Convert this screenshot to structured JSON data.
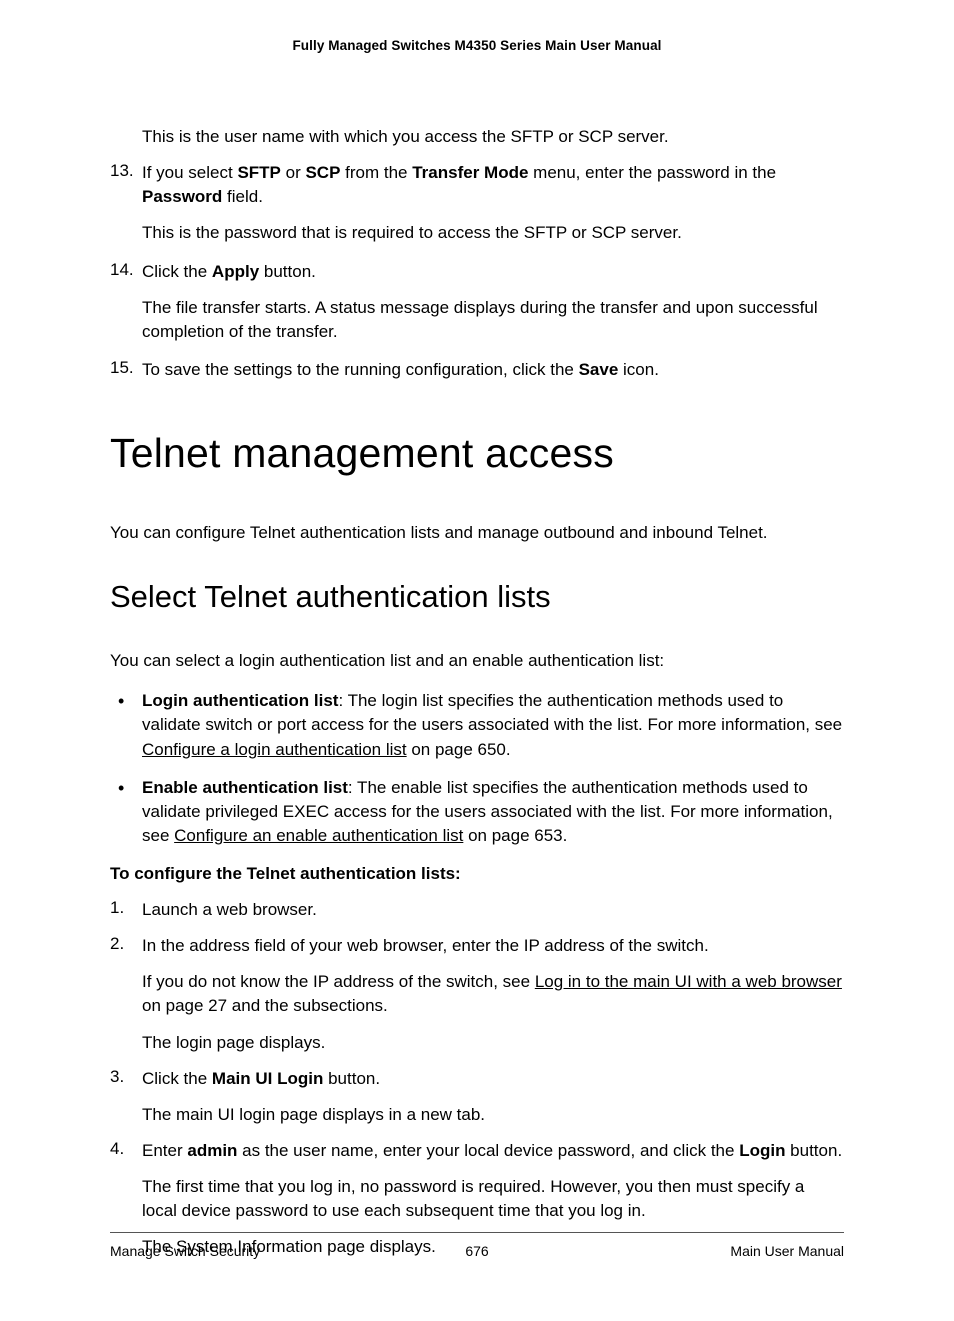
{
  "header": {
    "title": "Fully Managed Switches M4350 Series Main User Manual"
  },
  "cont": {
    "pre_indent": "This is the user name with which you access the SFTP or SCP server.",
    "items": [
      {
        "num": "13.",
        "body_html": "If you select <span class=\"bold\">SFTP</span> or <span class=\"bold\">SCP</span> from the <span class=\"bold\">Transfer Mode</span> menu, enter the password in the <span class=\"bold\">Password</span> field.",
        "after": "This is the password that is required to access the SFTP or SCP server."
      },
      {
        "num": "14.",
        "body_html": "Click the <span class=\"bold\">Apply</span> button.",
        "after": "The file transfer starts. A status message displays during the transfer and upon successful completion of the transfer."
      },
      {
        "num": "15.",
        "body_html": "To save the settings to the running configuration, click the <span class=\"bold\">Save</span> icon."
      }
    ]
  },
  "h1": "Telnet management access",
  "intro1": "You can configure Telnet authentication lists and manage outbound and inbound Telnet.",
  "h2": "Select Telnet authentication lists",
  "intro2": "You can select a login authentication list and an enable authentication list:",
  "bullets": [
    {
      "html": "<span class=\"bold\">Login authentication list</span>: The login list specifies the authentication methods used to validate switch or port access for the users associated with the list. For more information, see <span class=\"link\">Configure a login authentication list</span> on page 650."
    },
    {
      "html": "<span class=\"bold\">Enable authentication list</span>: The enable list specifies the authentication methods used to validate privileged EXEC access for the users associated with the list. For more information, see <span class=\"link\">Configure an enable authentication list</span> on page 653."
    }
  ],
  "proc_title": "To configure the Telnet authentication lists:",
  "proc": [
    {
      "num": "1.",
      "text": "Launch a web browser."
    },
    {
      "num": "2.",
      "text": "In the address field of your web browser, enter the IP address of the switch.",
      "subs": [
        {
          "html": "If you do not know the IP address of the switch, see <span class=\"link\">Log in to the main UI with a web browser</span> on page 27 and the subsections."
        },
        {
          "html": "The login page displays."
        }
      ]
    },
    {
      "num": "3.",
      "html": "Click the <span class=\"bold\">Main UI Login</span> button.",
      "subs": [
        {
          "html": "The main UI login page displays in a new tab."
        }
      ]
    },
    {
      "num": "4.",
      "html": "Enter <span class=\"bold\">admin</span> as the user name, enter your local device password, and click the <span class=\"bold\">Login</span> button.",
      "subs": [
        {
          "html": "The first time that you log in, no password is required. However, you then must specify a local device password to use each subsequent time that you log in."
        },
        {
          "html": "The System Information page displays."
        }
      ]
    }
  ],
  "footer": {
    "left": "Manage Switch Security",
    "center": "676",
    "right": "Main User Manual"
  }
}
